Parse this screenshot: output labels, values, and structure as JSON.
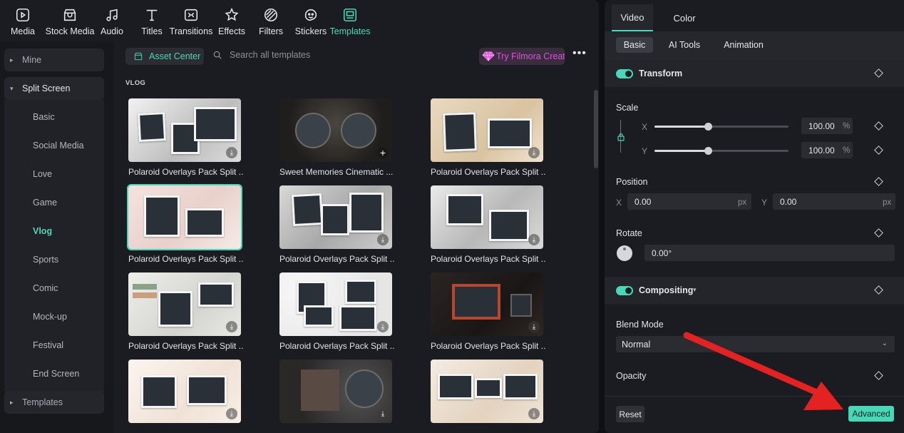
{
  "toolbar": {
    "items": [
      {
        "label": "Media",
        "icon": "media-icon"
      },
      {
        "label": "Stock Media",
        "icon": "stock-media-icon"
      },
      {
        "label": "Audio",
        "icon": "music-note-icon"
      },
      {
        "label": "Titles",
        "icon": "text-t-icon"
      },
      {
        "label": "Transitions",
        "icon": "transitions-icon"
      },
      {
        "label": "Effects",
        "icon": "effects-star-icon"
      },
      {
        "label": "Filters",
        "icon": "filters-icon"
      },
      {
        "label": "Stickers",
        "icon": "sticker-icon"
      },
      {
        "label": "Templates",
        "icon": "templates-icon"
      }
    ],
    "active": "Templates",
    "accent": "#48d8b8"
  },
  "sidebar": {
    "categories": [
      {
        "label": "Mine",
        "caret": "▸"
      },
      {
        "label": "Split Screen",
        "caret": "▾"
      },
      {
        "label": "Templates",
        "caret": "▸"
      }
    ],
    "subitems": [
      "Basic",
      "Social Media",
      "Love",
      "Game",
      "Vlog",
      "Sports",
      "Comic",
      "Mock-up",
      "Festival",
      "End Screen"
    ],
    "active_subitem": "Vlog"
  },
  "content": {
    "asset_center_label": "Asset Center",
    "search_placeholder": "Search all templates",
    "promo_label": "Try Filmora Creati",
    "more_label": "•••",
    "section_title": "VLOG",
    "cards": [
      {
        "title": "Polaroid Overlays Pack Split ...",
        "badge": "⤓"
      },
      {
        "title": "Sweet Memories Cinematic ...",
        "badge": "+"
      },
      {
        "title": "Polaroid Overlays Pack Split ...",
        "badge": "⤓"
      },
      {
        "title": "Polaroid Overlays Pack Split ...",
        "badge": ""
      },
      {
        "title": "Polaroid Overlays Pack Split ...",
        "badge": "⤓"
      },
      {
        "title": "Polaroid Overlays Pack Split ...",
        "badge": "⤓"
      },
      {
        "title": "Polaroid Overlays Pack Split ...",
        "badge": "⤓"
      },
      {
        "title": "Polaroid Overlays Pack Split ...",
        "badge": "⤓"
      },
      {
        "title": "Polaroid Overlays Pack Split ...",
        "badge": "⤓"
      },
      {
        "title": "",
        "badge": "⤓"
      },
      {
        "title": "",
        "badge": "⤓"
      },
      {
        "title": "",
        "badge": "⤓"
      }
    ],
    "selected_card": 3
  },
  "inspector": {
    "tabs": [
      "Video",
      "Color"
    ],
    "active_tab": "Video",
    "subtabs": [
      "Basic",
      "AI Tools",
      "Animation"
    ],
    "active_subtab": "Basic",
    "transform": {
      "title": "Transform",
      "scale_label": "Scale",
      "x_label": "X",
      "y_label": "Y",
      "scale_x": "100.00",
      "scale_y": "100.00",
      "scale_unit": "%",
      "scale_x_level": 0.4,
      "scale_y_level": 0.4,
      "position_label": "Position",
      "pos_x": "0.00",
      "pos_y": "0.00",
      "pos_unit": "px",
      "rotate_label": "Rotate",
      "rotate_value": "0.00°"
    },
    "compositing": {
      "title": "Compositing",
      "caret": "▾",
      "blend_label": "Blend Mode",
      "blend_value": "Normal",
      "blend_chevron": "⌄",
      "opacity_label": "Opacity"
    },
    "reset_label": "Reset",
    "advanced_label": "Advanced"
  }
}
